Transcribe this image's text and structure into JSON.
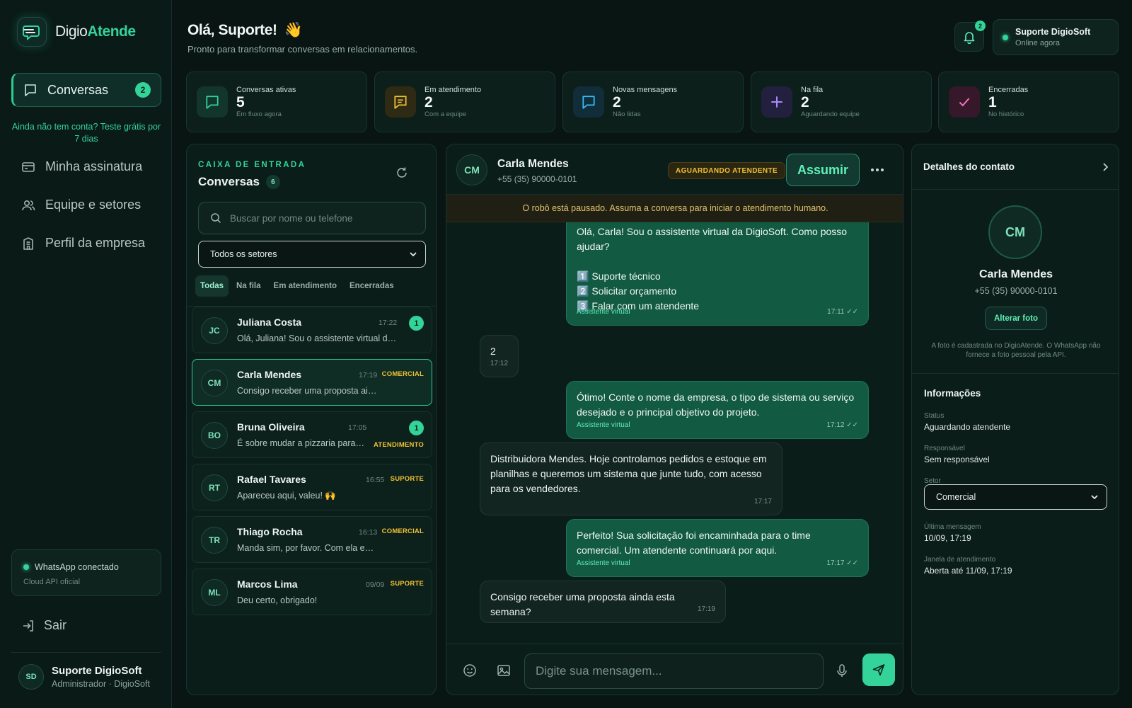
{
  "brand": {
    "prefix": "Digio",
    "suffix": "Atende"
  },
  "sidebar": {
    "nav_active": {
      "label": "Conversas",
      "count": "2"
    },
    "promo": "Ainda não tem conta? Teste grátis por 7 dias",
    "items": [
      {
        "label": "Minha assinatura",
        "icon": "card-icon"
      },
      {
        "label": "Equipe e setores",
        "icon": "users-icon"
      },
      {
        "label": "Perfil da empresa",
        "icon": "building-icon"
      }
    ],
    "whatsapp": {
      "status": "WhatsApp conectado",
      "sub": "Cloud API oficial"
    },
    "logout": "Sair",
    "user": {
      "initials": "SD",
      "name": "Suporte DigioSoft",
      "role": "Administrador · DigioSoft"
    }
  },
  "header": {
    "greeting": "Olá, Suporte!",
    "wave": "👋",
    "subtitle": "Pronto para transformar conversas em relacionamentos.",
    "notifications": "2",
    "user": {
      "name": "Suporte DigioSoft",
      "status": "Online agora"
    }
  },
  "stats": [
    {
      "title": "Conversas ativas",
      "value": "5",
      "desc": "Em fluxo agora",
      "icon": "chat-icon",
      "color": "#34d399"
    },
    {
      "title": "Em atendimento",
      "value": "2",
      "desc": "Com a equipe",
      "icon": "message-lines-icon",
      "color": "#f1c232"
    },
    {
      "title": "Novas mensagens",
      "value": "2",
      "desc": "Não lidas",
      "icon": "chat-icon",
      "color": "#38bdf8"
    },
    {
      "title": "Na fila",
      "value": "2",
      "desc": "Aguardando equipe",
      "icon": "plus-icon",
      "color": "#a78bfa"
    },
    {
      "title": "Encerradas",
      "value": "1",
      "desc": "No histórico",
      "icon": "check-icon",
      "color": "#f472b6"
    }
  ],
  "inbox": {
    "kicker": "CAIXA DE ENTRADA",
    "title": "Conversas",
    "count": "6",
    "search_placeholder": "Buscar por nome ou telefone",
    "sector_select": "Todos os setores",
    "filters": [
      "Todas",
      "Na fila",
      "Em atendimento",
      "Encerradas"
    ],
    "conversations": [
      {
        "initials": "JC",
        "name": "Juliana Costa",
        "time": "17:22",
        "preview": "Olá, Juliana! Sou o assistente virtual da Di...",
        "unread": "1",
        "tag": ""
      },
      {
        "initials": "CM",
        "name": "Carla Mendes",
        "time": "17:19",
        "preview": "Consigo receber uma proposta ain...",
        "unread": "",
        "tag": "COMERCIAL"
      },
      {
        "initials": "BO",
        "name": "Bruna Oliveira",
        "time": "17:05",
        "preview": "É sobre mudar a pizzaria para o ...",
        "unread": "1",
        "tag": "ATENDIMENTO"
      },
      {
        "initials": "RT",
        "name": "Rafael Tavares",
        "time": "16:55",
        "preview": "Apareceu aqui, valeu! 🙌",
        "unread": "",
        "tag": "SUPORTE"
      },
      {
        "initials": "TR",
        "name": "Thiago Rocha",
        "time": "16:13",
        "preview": "Manda sim, por favor. Com ela eu ...",
        "unread": "",
        "tag": "COMERCIAL"
      },
      {
        "initials": "ML",
        "name": "Marcos Lima",
        "time": "09/09",
        "preview": "Deu certo, obrigado!",
        "unread": "",
        "tag": "SUPORTE"
      }
    ]
  },
  "chat": {
    "contact": {
      "initials": "CM",
      "name": "Carla Mendes",
      "phone": "+55 (35) 90000-0101"
    },
    "status_badge": "AGUARDANDO ATENDENTE",
    "assume_label": "Assumir",
    "notice": "O robô está pausado. Assuma a conversa para iniciar o atendimento humano.",
    "messages": [
      {
        "dir": "out",
        "text": "Olá, Carla! Sou o assistente virtual da DigioSoft. Como posso ajudar?\n\n1️⃣ Suporte técnico\n2️⃣ Solicitar orçamento\n3️⃣ Falar com um atendente",
        "source": "Assistente virtual",
        "time": "17:11 ✓✓"
      },
      {
        "dir": "in",
        "text": "2",
        "source": "",
        "time": "17:12"
      },
      {
        "dir": "out",
        "text": "Ótimo! Conte o nome da empresa, o tipo de sistema ou serviço desejado e o principal objetivo do projeto.",
        "source": "Assistente virtual",
        "time": "17:12 ✓✓"
      },
      {
        "dir": "in",
        "text": "Distribuidora Mendes. Hoje controlamos pedidos e estoque em planilhas e queremos um sistema que junte tudo, com acesso para os vendedores.",
        "source": "",
        "time": "17:17"
      },
      {
        "dir": "out",
        "text": "Perfeito! Sua solicitação foi encaminhada para o time comercial. Um atendente continuará por aqui.",
        "source": "Assistente virtual",
        "time": "17:17 ✓✓"
      },
      {
        "dir": "in",
        "text": "Consigo receber uma proposta ainda esta semana?",
        "source": "",
        "time": "17:19"
      }
    ],
    "composer_placeholder": "Digite sua mensagem..."
  },
  "details": {
    "title": "Detalhes do contato",
    "initials": "CM",
    "name": "Carla Mendes",
    "phone": "+55 (35) 90000-0101",
    "change_photo": "Alterar foto",
    "photo_note": "A foto é cadastrada no DigioAtende. O WhatsApp não fornece a foto pessoal pela API.",
    "info_title": "Informações",
    "fields": {
      "status_label": "Status",
      "status": "Aguardando atendente",
      "owner_label": "Responsável",
      "owner": "Sem responsável",
      "sector_label": "Setor",
      "sector": "Comercial",
      "last_label": "Última mensagem",
      "last": "10/09, 17:19",
      "window_label": "Janela de atendimento",
      "window": "Aberta até 11/09, 17:19"
    }
  }
}
